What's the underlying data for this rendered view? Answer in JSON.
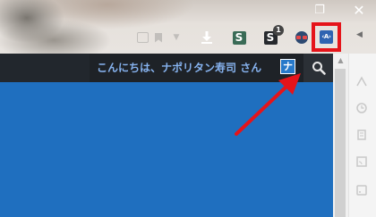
{
  "window": {
    "restore_icon": "restore-window-icon",
    "close_icon": "close-icon",
    "restore_glyph": "❐",
    "close_glyph": "✕"
  },
  "toolbar": {
    "extensions": [
      {
        "name": "camera-icon",
        "state": "faded"
      },
      {
        "name": "bookmark-icon",
        "state": "faded"
      },
      {
        "name": "dropdown-icon",
        "state": "faded"
      },
      {
        "name": "download-icon"
      },
      {
        "name": "s-green-extension-icon",
        "text": "S"
      },
      {
        "name": "s-dark-extension-icon",
        "text": "S",
        "badge": "1"
      },
      {
        "name": "glasses-extension-icon"
      },
      {
        "name": "code-extension-icon",
        "text": "‹A›",
        "highlighted": true
      }
    ],
    "overflow_glyph": "◀"
  },
  "adminbar": {
    "greeting": "こんにちは、ナポリタン寿司 さん",
    "avatar_text": "ナ",
    "search_icon": "search-icon"
  },
  "scrollbar": {
    "up_glyph": "▲"
  },
  "sidepanel": {
    "icons": [
      "history-icon",
      "clock-icon",
      "notes-icon",
      "rss-icon"
    ]
  },
  "colors": {
    "adminbar_bg": "#1e2227",
    "page_bg": "#1f6fbf",
    "greeting_text": "#86b2ee",
    "highlight": "#e5141a",
    "arrow": "#e5141a"
  }
}
